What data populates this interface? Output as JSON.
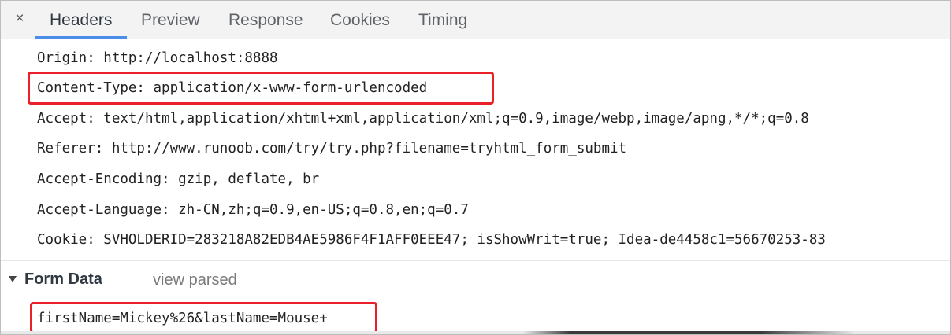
{
  "tabs": {
    "close": "×",
    "items": [
      "Headers",
      "Preview",
      "Response",
      "Cookies",
      "Timing"
    ]
  },
  "headers": [
    "Origin: http://localhost:8888",
    "Content-Type: application/x-www-form-urlencoded",
    "Accept: text/html,application/xhtml+xml,application/xml;q=0.9,image/webp,image/apng,*/*;q=0.8",
    "Referer: http://www.runoob.com/try/try.php?filename=tryhtml_form_submit",
    "Accept-Encoding: gzip, deflate, br",
    "Accept-Language: zh-CN,zh;q=0.9,en-US;q=0.8,en;q=0.7",
    "Cookie: SVHOLDERID=283218A82EDB4AE5986F4F1AFF0EEE47; isShowWrit=true; Idea-de4458c1=56670253-83"
  ],
  "form_data": {
    "title": "Form Data",
    "view_parsed": "view parsed",
    "value": "firstName=Mickey%26&lastName=Mouse+"
  },
  "colors": {
    "highlight": "#e8202a",
    "active_tab_underline": "#4a8ee8"
  }
}
